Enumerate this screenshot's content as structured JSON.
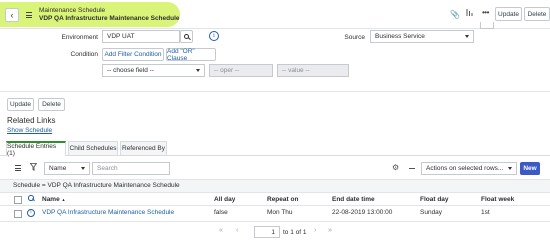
{
  "header": {
    "back_icon": "chevron-left-icon",
    "menu_icon": "hamburger-icon",
    "record_type": "Maintenance Schedule",
    "record_name": "VDP QA Infrastructure Maintenance Schedule",
    "update_label": "Update",
    "delete_label": "Delete"
  },
  "form": {
    "environment_label": "Environment",
    "environment_value": "VDP UAT",
    "condition_label": "Condition",
    "add_filter_label": "Add Filter Condition",
    "add_or_label": "Add \"OR\" Clause",
    "choose_field_placeholder": "-- choose field --",
    "oper_placeholder": "-- oper --",
    "value_placeholder": "-- value --",
    "source_label": "Source",
    "source_value": "Business Service"
  },
  "actions": {
    "update_label": "Update",
    "delete_label": "Delete"
  },
  "related": {
    "title": "Related Links",
    "show_schedule": "Show Schedule",
    "tabs": [
      {
        "label": "Schedule Entries (1)",
        "active": true
      },
      {
        "label": "Child Schedules",
        "active": false
      },
      {
        "label": "Referenced By",
        "active": false
      }
    ]
  },
  "list": {
    "search_field": "Name",
    "search_placeholder": "Search",
    "actions_select": "Actions on selected rows...",
    "new_label": "New",
    "breadcrumb": "Schedule = VDP QA Infrastructure Maintenance Schedule",
    "columns": [
      "Name",
      "All day",
      "Repeat on",
      "End date time",
      "Float day",
      "Float week"
    ],
    "sort_indicator": "▲",
    "rows": [
      {
        "name": "VDP QA Infrastructure Maintenance Schedule",
        "all_day": "false",
        "repeat_on": "Mon Thu",
        "end_date_time": "22-08-2019 13:00:00",
        "float_day": "Sunday",
        "float_week": "1st"
      }
    ],
    "pagination": {
      "first": "«",
      "prev": "‹",
      "current": "1",
      "of_text": "to 1 of 1",
      "next": "›",
      "last": "»"
    }
  },
  "colors": {
    "accent": "#1f5fa5",
    "new_button": "#3c59c6",
    "highlight": "#d6f26a"
  }
}
